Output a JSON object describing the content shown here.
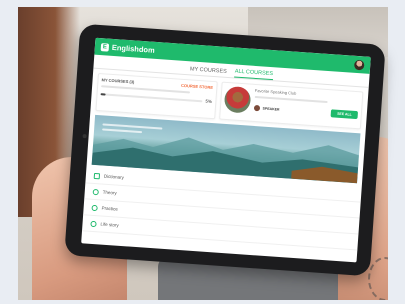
{
  "app": {
    "name": "Englishdom",
    "logo_letter": "E"
  },
  "tabs": [
    {
      "label": "MY COURSES",
      "active": false
    },
    {
      "label": "ALL COURSES",
      "active": true
    }
  ],
  "courses_card": {
    "label": "MY COURSES (3)",
    "store_label": "COURSE STORE",
    "progress_percent": 5,
    "progress_text": "5%"
  },
  "teacher_card": {
    "title": "Favorite Speaking Club",
    "speaker_label": "SPEAKER",
    "see_all_label": "SEE ALL"
  },
  "menu": [
    {
      "label": "Dictionary",
      "icon": "book-icon"
    },
    {
      "label": "Theory",
      "icon": "theory-icon"
    },
    {
      "label": "Practice",
      "icon": "practice-icon"
    },
    {
      "label": "Life story",
      "icon": "clock-icon"
    }
  ],
  "colors": {
    "brand": "#1fba6c",
    "store": "#f26b3a"
  }
}
